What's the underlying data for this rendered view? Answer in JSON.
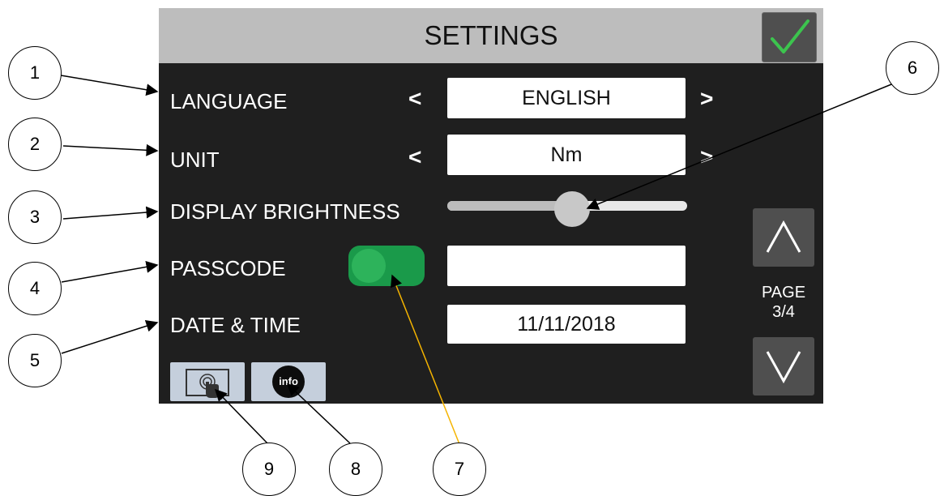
{
  "header": {
    "title": "SETTINGS",
    "confirm_icon": "checkmark-icon"
  },
  "settings": {
    "language": {
      "label": "LANGUAGE",
      "prev": "<",
      "next": ">",
      "value": "ENGLISH"
    },
    "unit": {
      "label": "UNIT",
      "prev": "<",
      "next": ">",
      "value": "Nm"
    },
    "brightness": {
      "label": "DISPLAY BRIGHTNESS",
      "level_percent": 52
    },
    "passcode": {
      "label": "PASSCODE",
      "toggle_on": true,
      "value": ""
    },
    "date_time": {
      "label": "DATE & TIME",
      "value": "11/11/2018"
    }
  },
  "pager": {
    "line1": "PAGE",
    "line2": "3/4",
    "up_icon": "chevron-up-icon",
    "down_icon": "chevron-down-icon"
  },
  "bottom": {
    "touch_icon": "touch-screen-icon",
    "info_label": "info"
  },
  "callouts": [
    "1",
    "2",
    "3",
    "4",
    "5",
    "6",
    "7",
    "8",
    "9"
  ],
  "colors": {
    "screen_bg": "#1f1f1f",
    "title_bar": "#bdbdbd",
    "confirm_check": "#3cc44e",
    "toggle_on": "#1a9a4a",
    "pointer_yellow": "#f5b400"
  }
}
